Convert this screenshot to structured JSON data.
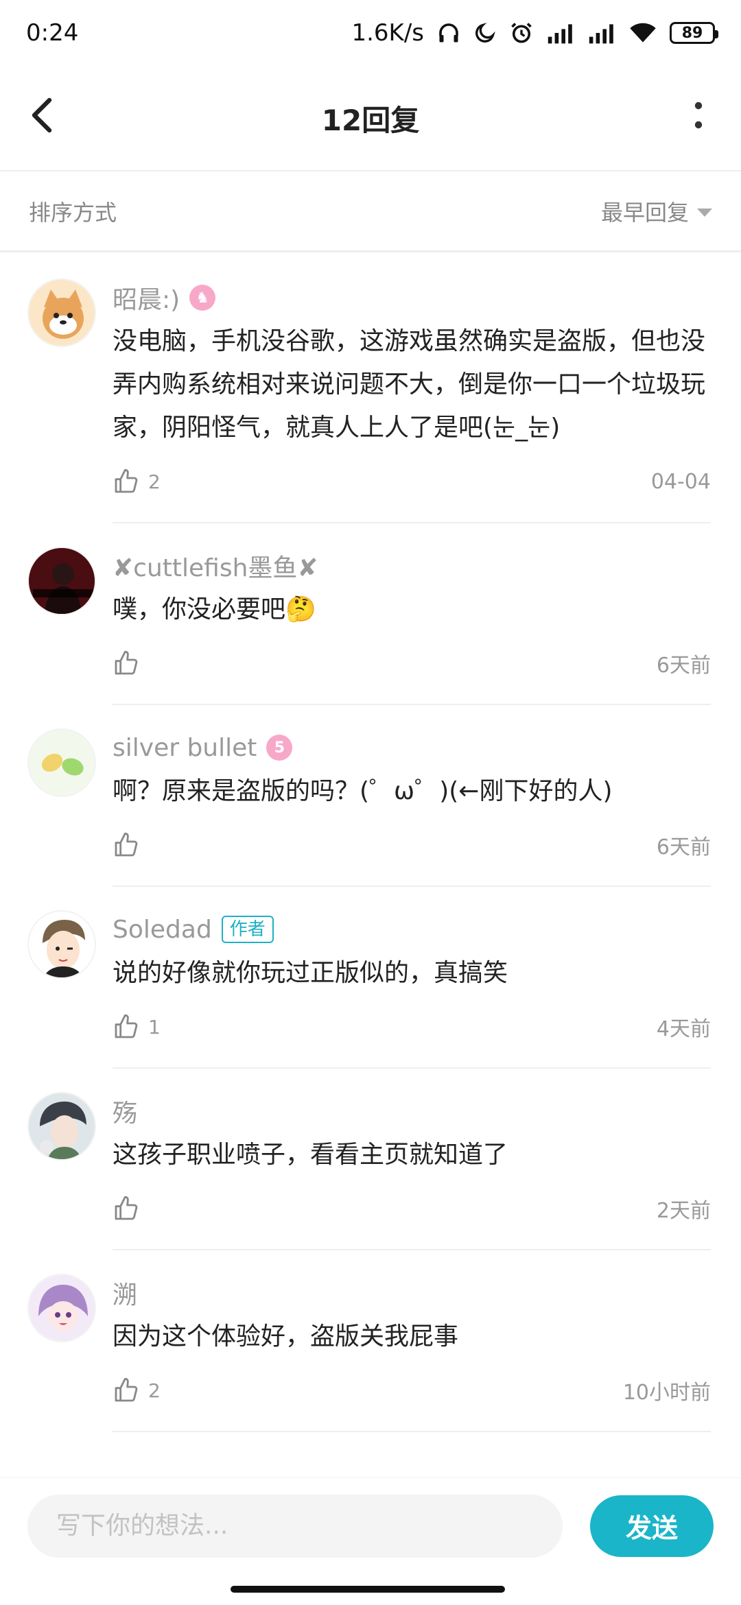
{
  "status_bar": {
    "time": "0:24",
    "speed": "1.6K/s",
    "battery": "89"
  },
  "header": {
    "title": "12回复"
  },
  "sort": {
    "label": "排序方式",
    "value": "最早回复"
  },
  "comments": [
    {
      "name": "昭晨:)",
      "badge": "♞",
      "text": "没电脑，手机没谷歌，这游戏虽然确实是盗版，但也没弄内购系统相对来说问题不大，倒是你一口一个垃圾玩家，阴阳怪气，就真人上人了是吧(눈_눈)",
      "likes": "2",
      "time": "04-04"
    },
    {
      "name": "✘cuttlefish墨鱼✘",
      "text": "噗，你没必要吧🤔",
      "likes": "",
      "time": "6天前"
    },
    {
      "name": "silver bullet",
      "badge": "5",
      "text": "啊？原来是盗版的吗？(゜ω゜)(←刚下好的人)",
      "likes": "",
      "time": "6天前"
    },
    {
      "name": "Soledad",
      "author_tag": "作者",
      "text": "说的好像就你玩过正版似的，真搞笑",
      "likes": "1",
      "time": "4天前"
    },
    {
      "name": "殇",
      "text": "这孩子职业喷子，看看主页就知道了",
      "likes": "",
      "time": "2天前"
    },
    {
      "name": "溯",
      "text": "因为这个体验好，盗版关我屁事",
      "likes": "2",
      "time": "10小时前"
    }
  ],
  "input": {
    "placeholder": "写下你的想法..."
  },
  "send": {
    "label": "发送"
  }
}
